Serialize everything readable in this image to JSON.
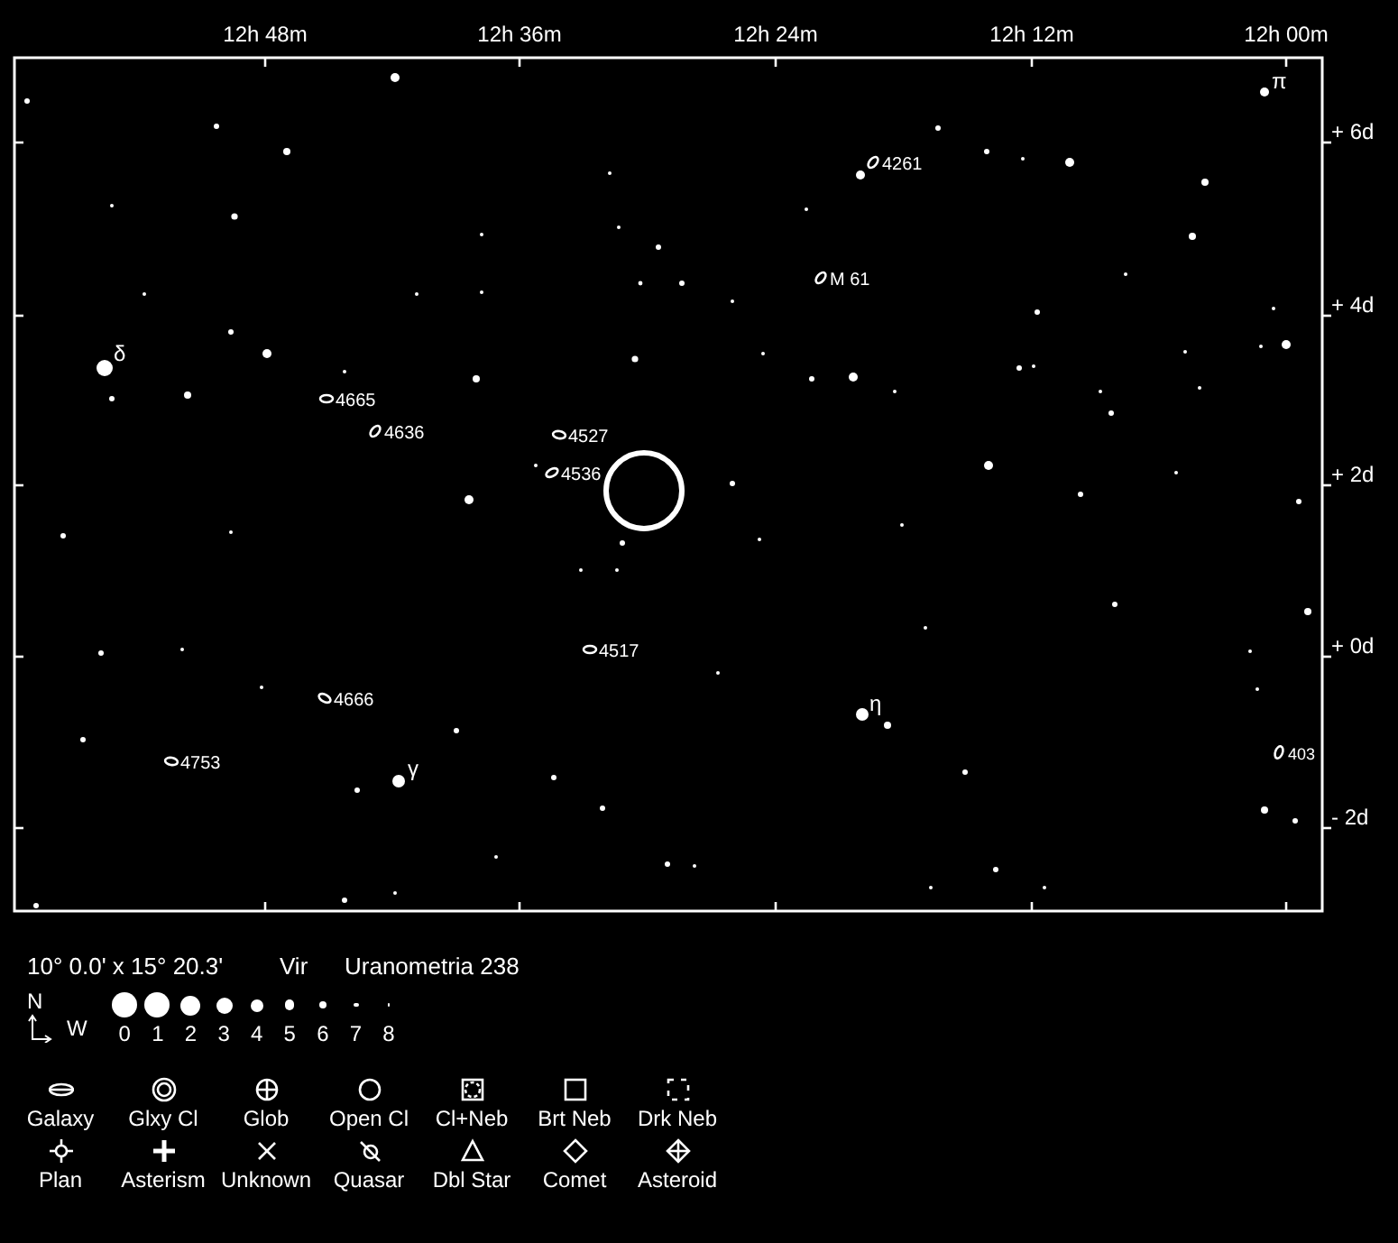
{
  "chart": {
    "ra_labels": [
      "12h 48m",
      "12h 36m",
      "12h 24m",
      "12h 12m",
      "12h 00m"
    ],
    "dec_labels": [
      "+ 6d",
      "+ 4d",
      "+ 2d",
      "+ 0d",
      "- 2d"
    ],
    "star_labels": [
      "δ",
      "π",
      "γ",
      "η"
    ],
    "objects": [
      {
        "label": "4261",
        "kind": "galaxy"
      },
      {
        "label": "M 61",
        "kind": "galaxy"
      },
      {
        "label": "4665",
        "kind": "galaxy"
      },
      {
        "label": "4636",
        "kind": "galaxy"
      },
      {
        "label": "4527",
        "kind": "galaxy"
      },
      {
        "label": "4536",
        "kind": "galaxy"
      },
      {
        "label": "4517",
        "kind": "galaxy"
      },
      {
        "label": "4666",
        "kind": "galaxy"
      },
      {
        "label": "4753",
        "kind": "galaxy"
      },
      {
        "label": "403",
        "kind": "galaxy"
      }
    ]
  },
  "legend": {
    "field": "10° 0.0' x 15° 20.3'",
    "constellation": "Vir",
    "atlas": "Uranometria 238",
    "compass": {
      "north": "N",
      "west": "W"
    },
    "magnitudes": [
      "0",
      "1",
      "2",
      "3",
      "4",
      "5",
      "6",
      "7",
      "8"
    ],
    "symbols": [
      {
        "label": "Galaxy",
        "kind": "galaxy"
      },
      {
        "label": "Glxy Cl",
        "kind": "galaxy_cluster"
      },
      {
        "label": "Glob",
        "kind": "globular"
      },
      {
        "label": "Open Cl",
        "kind": "open_cluster"
      },
      {
        "label": "Cl+Neb",
        "kind": "cluster_nebula"
      },
      {
        "label": "Brt Neb",
        "kind": "bright_nebula"
      },
      {
        "label": "Drk Neb",
        "kind": "dark_nebula"
      },
      {
        "label": "Plan",
        "kind": "planet"
      },
      {
        "label": "Asterism",
        "kind": "asterism"
      },
      {
        "label": "Unknown",
        "kind": "unknown"
      },
      {
        "label": "Quasar",
        "kind": "quasar"
      },
      {
        "label": "Dbl Star",
        "kind": "double_star"
      },
      {
        "label": "Comet",
        "kind": "comet"
      },
      {
        "label": "Asteroid",
        "kind": "asteroid"
      }
    ]
  }
}
